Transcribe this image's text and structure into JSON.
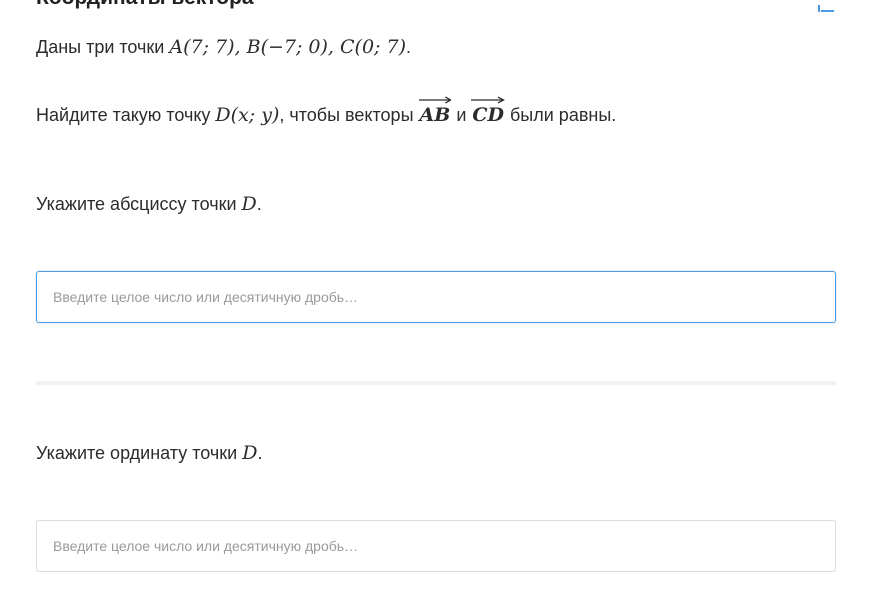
{
  "header": {
    "title": "Координаты вектора"
  },
  "problem": {
    "line1_prefix": "Даны три точки ",
    "line1_math": "A(7; 7), B(−7; 0), C(0; 7)",
    "line1_suffix": ".",
    "line2_prefix": "Найдите такую точку ",
    "line2_point": "D(x; y)",
    "line2_mid": ", чтобы векторы ",
    "vector_1": "AB",
    "line2_and": " и ",
    "vector_2": "CD",
    "line2_suffix": " были равны."
  },
  "question_1": {
    "text_prefix": "Укажите абсциссу точки ",
    "point": "D",
    "text_suffix": ".",
    "input_value": "",
    "placeholder": "Введите целое число или десятичную дробь…"
  },
  "question_2": {
    "text_prefix": "Укажите ординату точки ",
    "point": "D",
    "text_suffix": ".",
    "input_value": "",
    "placeholder": "Введите целое число или десятичную дробь…"
  },
  "icons": {
    "corner": "list-icon"
  },
  "colors": {
    "focus_border": "#4a9be4",
    "input_border": "#dcdcdc",
    "placeholder": "#9a9a9a",
    "divider": "#f3f3f3",
    "icon": "#4a9be4"
  }
}
